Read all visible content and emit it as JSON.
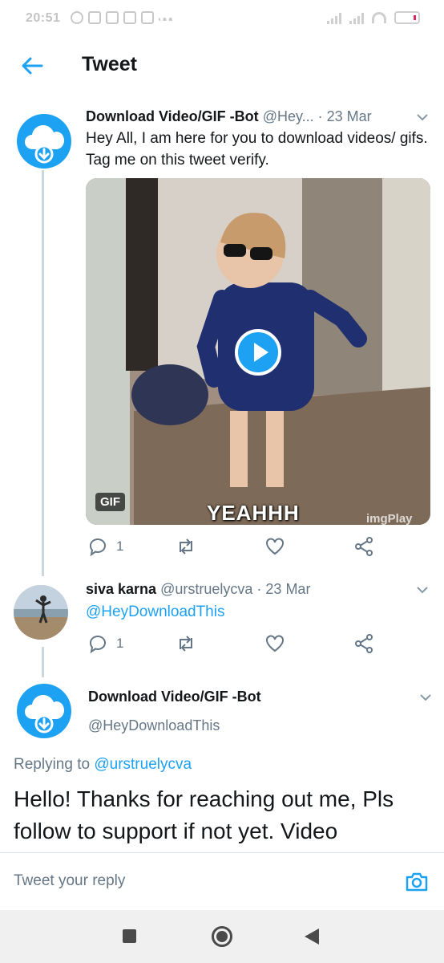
{
  "status_bar": {
    "time": "20:51"
  },
  "header": {
    "title": "Tweet"
  },
  "tweet1": {
    "name": "Download Video/GIF -Bot",
    "handle": "@Hey...",
    "date": "· 23 Mar",
    "text": "Hey All, I am here for you to download videos/ gifs. Tag me on this tweet verify.",
    "media": {
      "badge": "GIF",
      "caption": "YEAHHH",
      "watermark": "imgPlay"
    },
    "reply_count": "1"
  },
  "tweet2": {
    "name": "siva karna",
    "handle": "@urstruelycva",
    "date": "· 23 Mar",
    "mention": "@HeyDownloadThis",
    "reply_count": "1"
  },
  "tweet3": {
    "name": "Download Video/GIF -Bot",
    "handle": "@HeyDownloadThis",
    "replying_label": "Replying to",
    "replying_to": "@urstruelycva",
    "text": "Hello! Thanks for reaching out me, Pls follow to support if not yet. Video"
  },
  "reply_bar": {
    "placeholder": "Tweet your reply"
  },
  "colors": {
    "accent": "#1da1f2",
    "secondary_text": "#657786"
  },
  "icons": [
    "back-arrow-icon",
    "cloud-download-icon",
    "chevron-down-icon",
    "reply-icon",
    "retweet-icon",
    "like-icon",
    "share-icon",
    "play-icon",
    "camera-icon"
  ]
}
